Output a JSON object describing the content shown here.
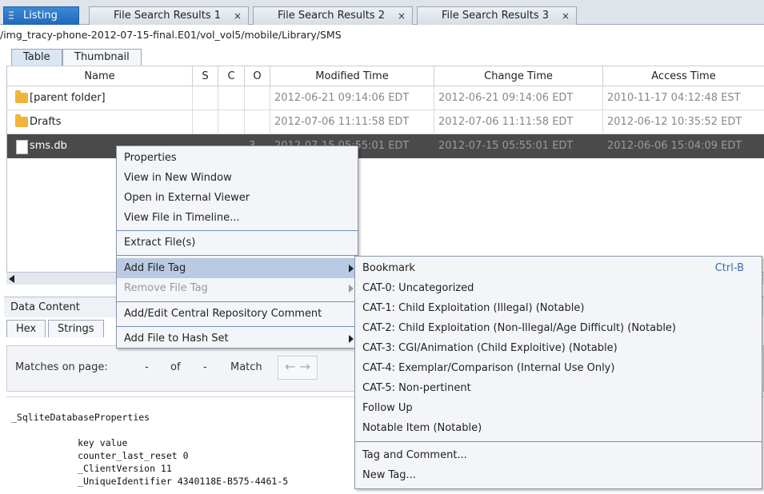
{
  "tabs": [
    "Listing",
    "File Search Results 1",
    "File Search Results 2",
    "File Search Results 3"
  ],
  "close_glyph": "×",
  "path": "/img_tracy-phone-2012-07-15-final.E01/vol_vol5/mobile/Library/SMS",
  "view_tabs": [
    "Table",
    "Thumbnail"
  ],
  "columns": [
    "Name",
    "S",
    "C",
    "O",
    "Modified Time",
    "Change Time",
    "Access Time"
  ],
  "rows": [
    {
      "name": "[parent folder]",
      "s": "",
      "c": "",
      "o": "",
      "modified": "2012-06-21 09:14:06 EDT",
      "change": "2012-06-21 09:14:06 EDT",
      "access": "2010-11-17 04:12:48 EST",
      "icon": "folder-icon"
    },
    {
      "name": "Drafts",
      "s": "",
      "c": "",
      "o": "",
      "modified": "2012-07-06 11:11:58 EDT",
      "change": "2012-07-06 11:11:58 EDT",
      "access": "2012-06-12 10:35:52 EDT",
      "icon": "folder-icon"
    },
    {
      "name": "sms.db",
      "s": "",
      "c": "",
      "o": "3",
      "modified": "2012-07-15 05:55:01 EDT",
      "change": "2012-07-15 05:55:01 EDT",
      "access": "2012-06-06 15:04:09 EDT",
      "icon": "file-icon"
    }
  ],
  "data_content": {
    "title": "Data Content",
    "tabs": [
      "Hex",
      "Strings"
    ],
    "matches_label": "Matches on page:",
    "dash1": "-",
    "of_label": "of",
    "dash2": "-",
    "match_label": "Match",
    "nav_arrows": "← →",
    "text_lines": [
      "_SqliteDatabaseProperties",
      "",
      "            key value",
      "            counter_last_reset 0",
      "            _ClientVersion 11",
      "            _UniqueIdentifier 4340118E-B575-4461-5"
    ]
  },
  "context_menu": {
    "items": [
      "Properties",
      "View in New Window",
      "Open in External Viewer",
      "View File in Timeline...",
      "Extract File(s)",
      "Add File Tag",
      "Remove File Tag",
      "Add/Edit Central Repository Comment",
      "Add File to Hash Set"
    ]
  },
  "tag_submenu": {
    "items": [
      "Bookmark",
      "CAT-0: Uncategorized",
      "CAT-1: Child Exploitation (Illegal) (Notable)",
      "CAT-2: Child Exploitation (Non-Illegal/Age Difficult) (Notable)",
      "CAT-3: CGI/Animation (Child Exploitive) (Notable)",
      "CAT-4: Exemplar/Comparison (Internal Use Only)",
      "CAT-5: Non-pertinent",
      "Follow Up",
      "Notable Item (Notable)",
      "Tag and Comment...",
      "New Tag..."
    ],
    "bookmark_shortcut": "Ctrl-B"
  }
}
